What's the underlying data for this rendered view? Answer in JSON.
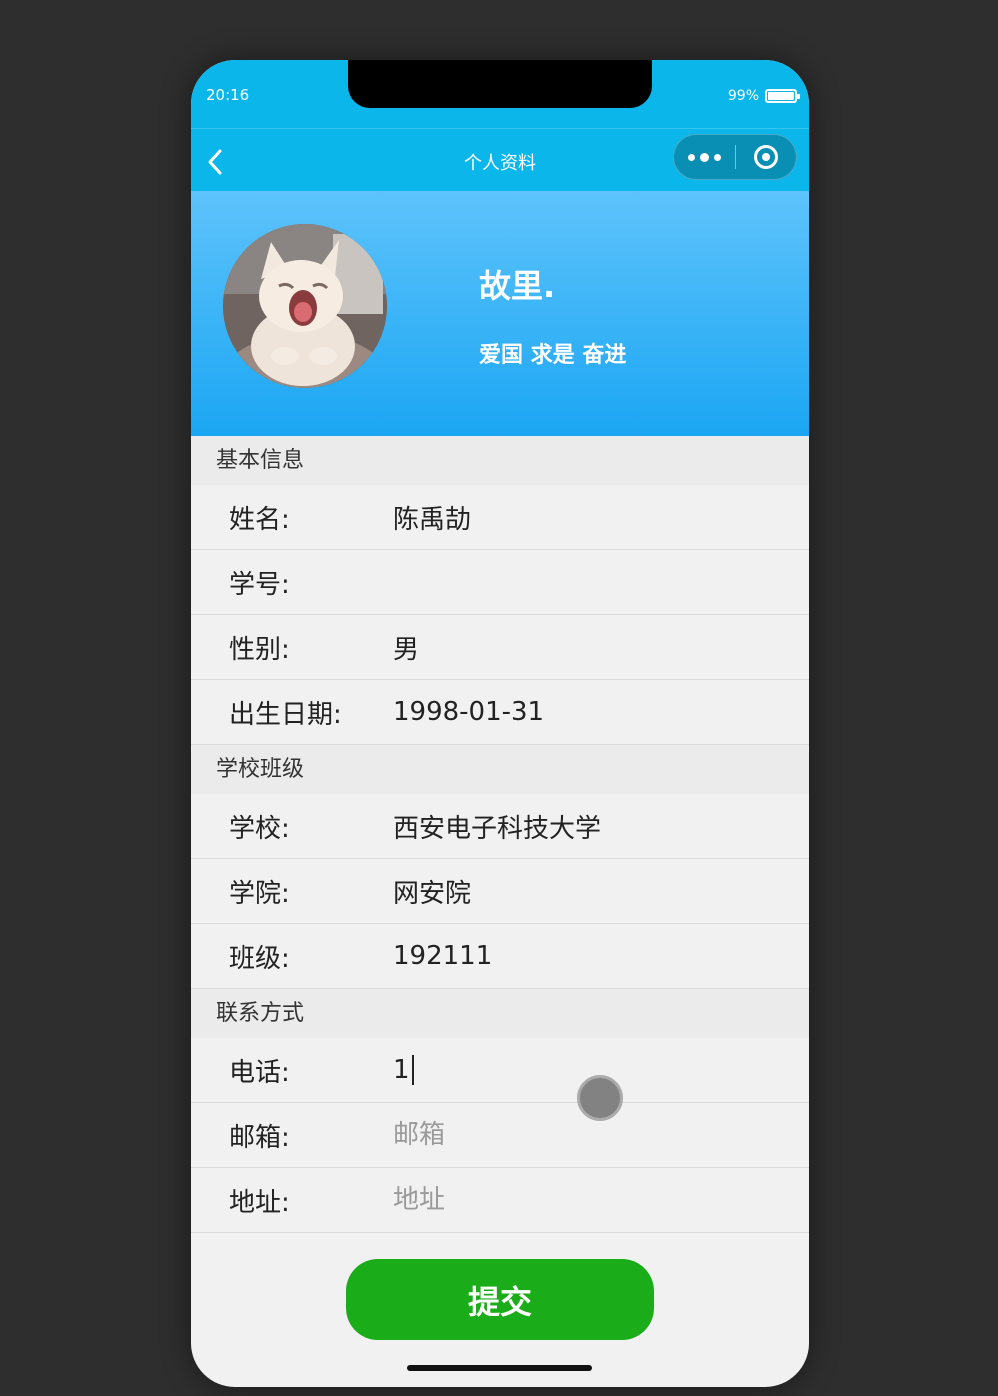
{
  "status_bar": {
    "time": "20:16",
    "battery_text": "99%",
    "battery_level": 0.99
  },
  "nav": {
    "title": "个人资料"
  },
  "profile": {
    "name": "故里.",
    "motto": "爱国 求是 奋进"
  },
  "sections": {
    "basic": {
      "header": "基本信息",
      "name_label": "姓名:",
      "name_value": "陈禹劼",
      "student_id_label": "学号:",
      "student_id_value": "",
      "gender_label": "性别:",
      "gender_value": "男",
      "birth_label": "出生日期:",
      "birth_value": "1998-01-31"
    },
    "school": {
      "header": "学校班级",
      "school_label": "学校:",
      "school_value": "西安电子科技大学",
      "college_label": "学院:",
      "college_value": "网安院",
      "class_label": "班级:",
      "class_value": "192111"
    },
    "contact": {
      "header": "联系方式",
      "phone_label": "电话:",
      "phone_value": "1",
      "email_label": "邮箱:",
      "email_placeholder": "邮箱",
      "address_label": "地址:",
      "address_placeholder": "地址"
    }
  },
  "submit": {
    "label": "提交"
  },
  "colors": {
    "nav_bg": "#0bb7ea",
    "hero_top": "#5ec3fb",
    "hero_bottom": "#1ba6f3",
    "submit_bg": "#1aac19"
  }
}
